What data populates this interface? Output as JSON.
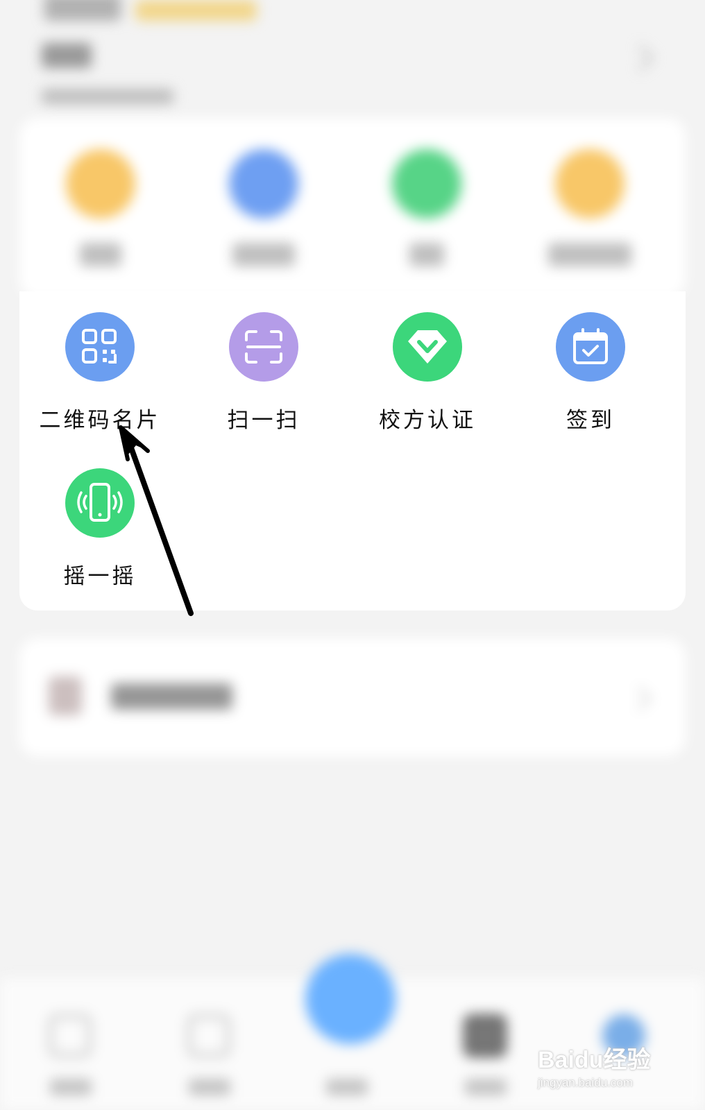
{
  "features": [
    {
      "label": "二维码名片",
      "icon": "qr-code-icon",
      "color": "#6b9ef0"
    },
    {
      "label": "扫一扫",
      "icon": "scan-icon",
      "color": "#b49ce8"
    },
    {
      "label": "校方认证",
      "icon": "diamond-check-icon",
      "color": "#3cd67b"
    },
    {
      "label": "签到",
      "icon": "calendar-check-icon",
      "color": "#6b9ef0"
    },
    {
      "label": "摇一摇",
      "icon": "phone-shake-icon",
      "color": "#3cd67b"
    }
  ],
  "background": {
    "top_icon_colors": [
      "#f8c768",
      "#6e9ff2",
      "#57d487",
      "#f8c768"
    ],
    "fab_color": "#6ab1ff"
  },
  "watermark": {
    "brand": "Baidu经验",
    "url": "jingyan.baidu.com"
  }
}
